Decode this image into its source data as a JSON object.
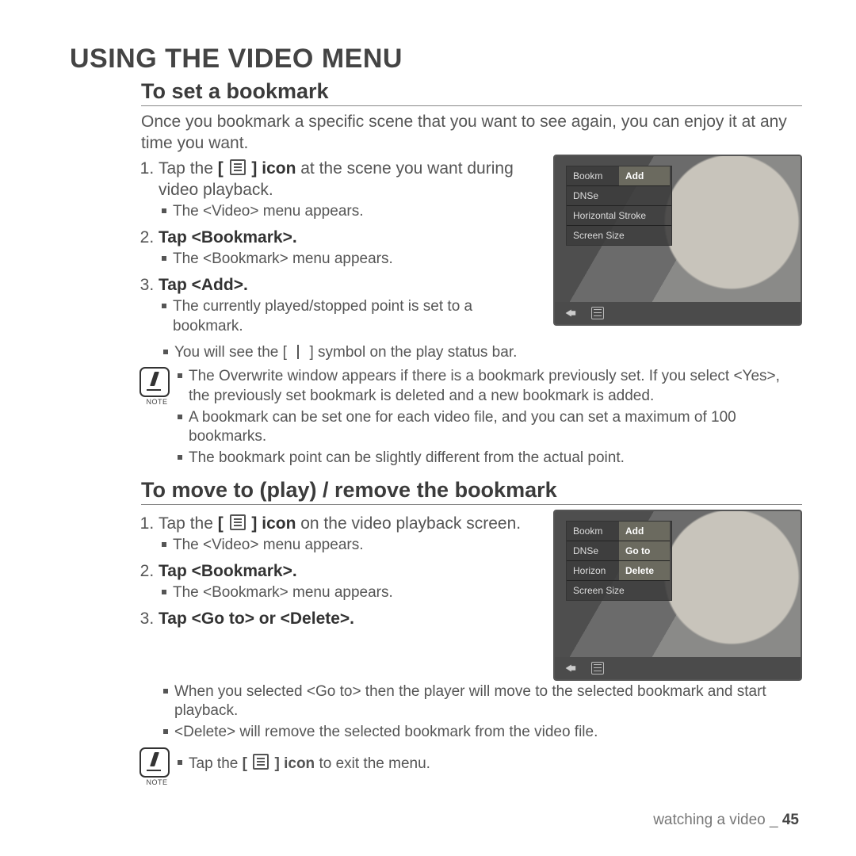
{
  "page": {
    "title": "USING THE VIDEO MENU",
    "footer_section": "watching a video _",
    "footer_page": "45"
  },
  "section1": {
    "heading": "To set a bookmark",
    "intro": "Once you bookmark a specific scene that you want to see again, you can enjoy it at any time you want.",
    "step1_pre": "Tap the ",
    "step1_iconlabel": "icon",
    "step1_post": " at the scene you want during video playback.",
    "step1_sub1": "The <Video> menu appears.",
    "step2": "Tap <Bookmark>.",
    "step2_sub1": "The <Bookmark> menu appears.",
    "step3": "Tap <Add>.",
    "step3_sub1": "The currently played/stopped point is set to a bookmark.",
    "step3_sub2_pre": "You will see the ",
    "step3_sub2_post": "symbol on the play status bar.",
    "note_label": "NOTE",
    "note1": "The Overwrite window appears if there is a bookmark previously set. If you select <Yes>, the previously set bookmark is deleted and a new bookmark is added.",
    "note2": "A bookmark can be set one for each video file, and you can set a maximum of 100 bookmarks.",
    "note3": "The bookmark point can be slightly different from the actual point.",
    "fig": {
      "col1": [
        "Bookm",
        "DNSe",
        "Horizontal Stroke",
        "Screen Size"
      ],
      "col2": [
        "Add"
      ]
    }
  },
  "section2": {
    "heading": "To move to (play) / remove the bookmark",
    "step1_pre": "Tap the ",
    "step1_iconlabel": "icon",
    "step1_post": " on the video playback screen.",
    "step1_sub1": "The <Video> menu appears.",
    "step2": "Tap <Bookmark>.",
    "step2_sub1": "The <Bookmark> menu appears.",
    "step3": "Tap <Go to> or <Delete>.",
    "step3_sub1": "When you selected <Go to> then the player will move to the selected bookmark and start playback.",
    "step3_sub2": "<Delete> will remove the selected bookmark from the video file.",
    "note_label": "NOTE",
    "note1_pre": "Tap the ",
    "note1_iconlabel": "icon",
    "note1_post": " to exit the menu.",
    "fig": {
      "col1": [
        "Bookm",
        "DNSe",
        "Horizon",
        "Screen Size"
      ],
      "col2": [
        "Add",
        "Go to",
        "Delete"
      ]
    }
  }
}
